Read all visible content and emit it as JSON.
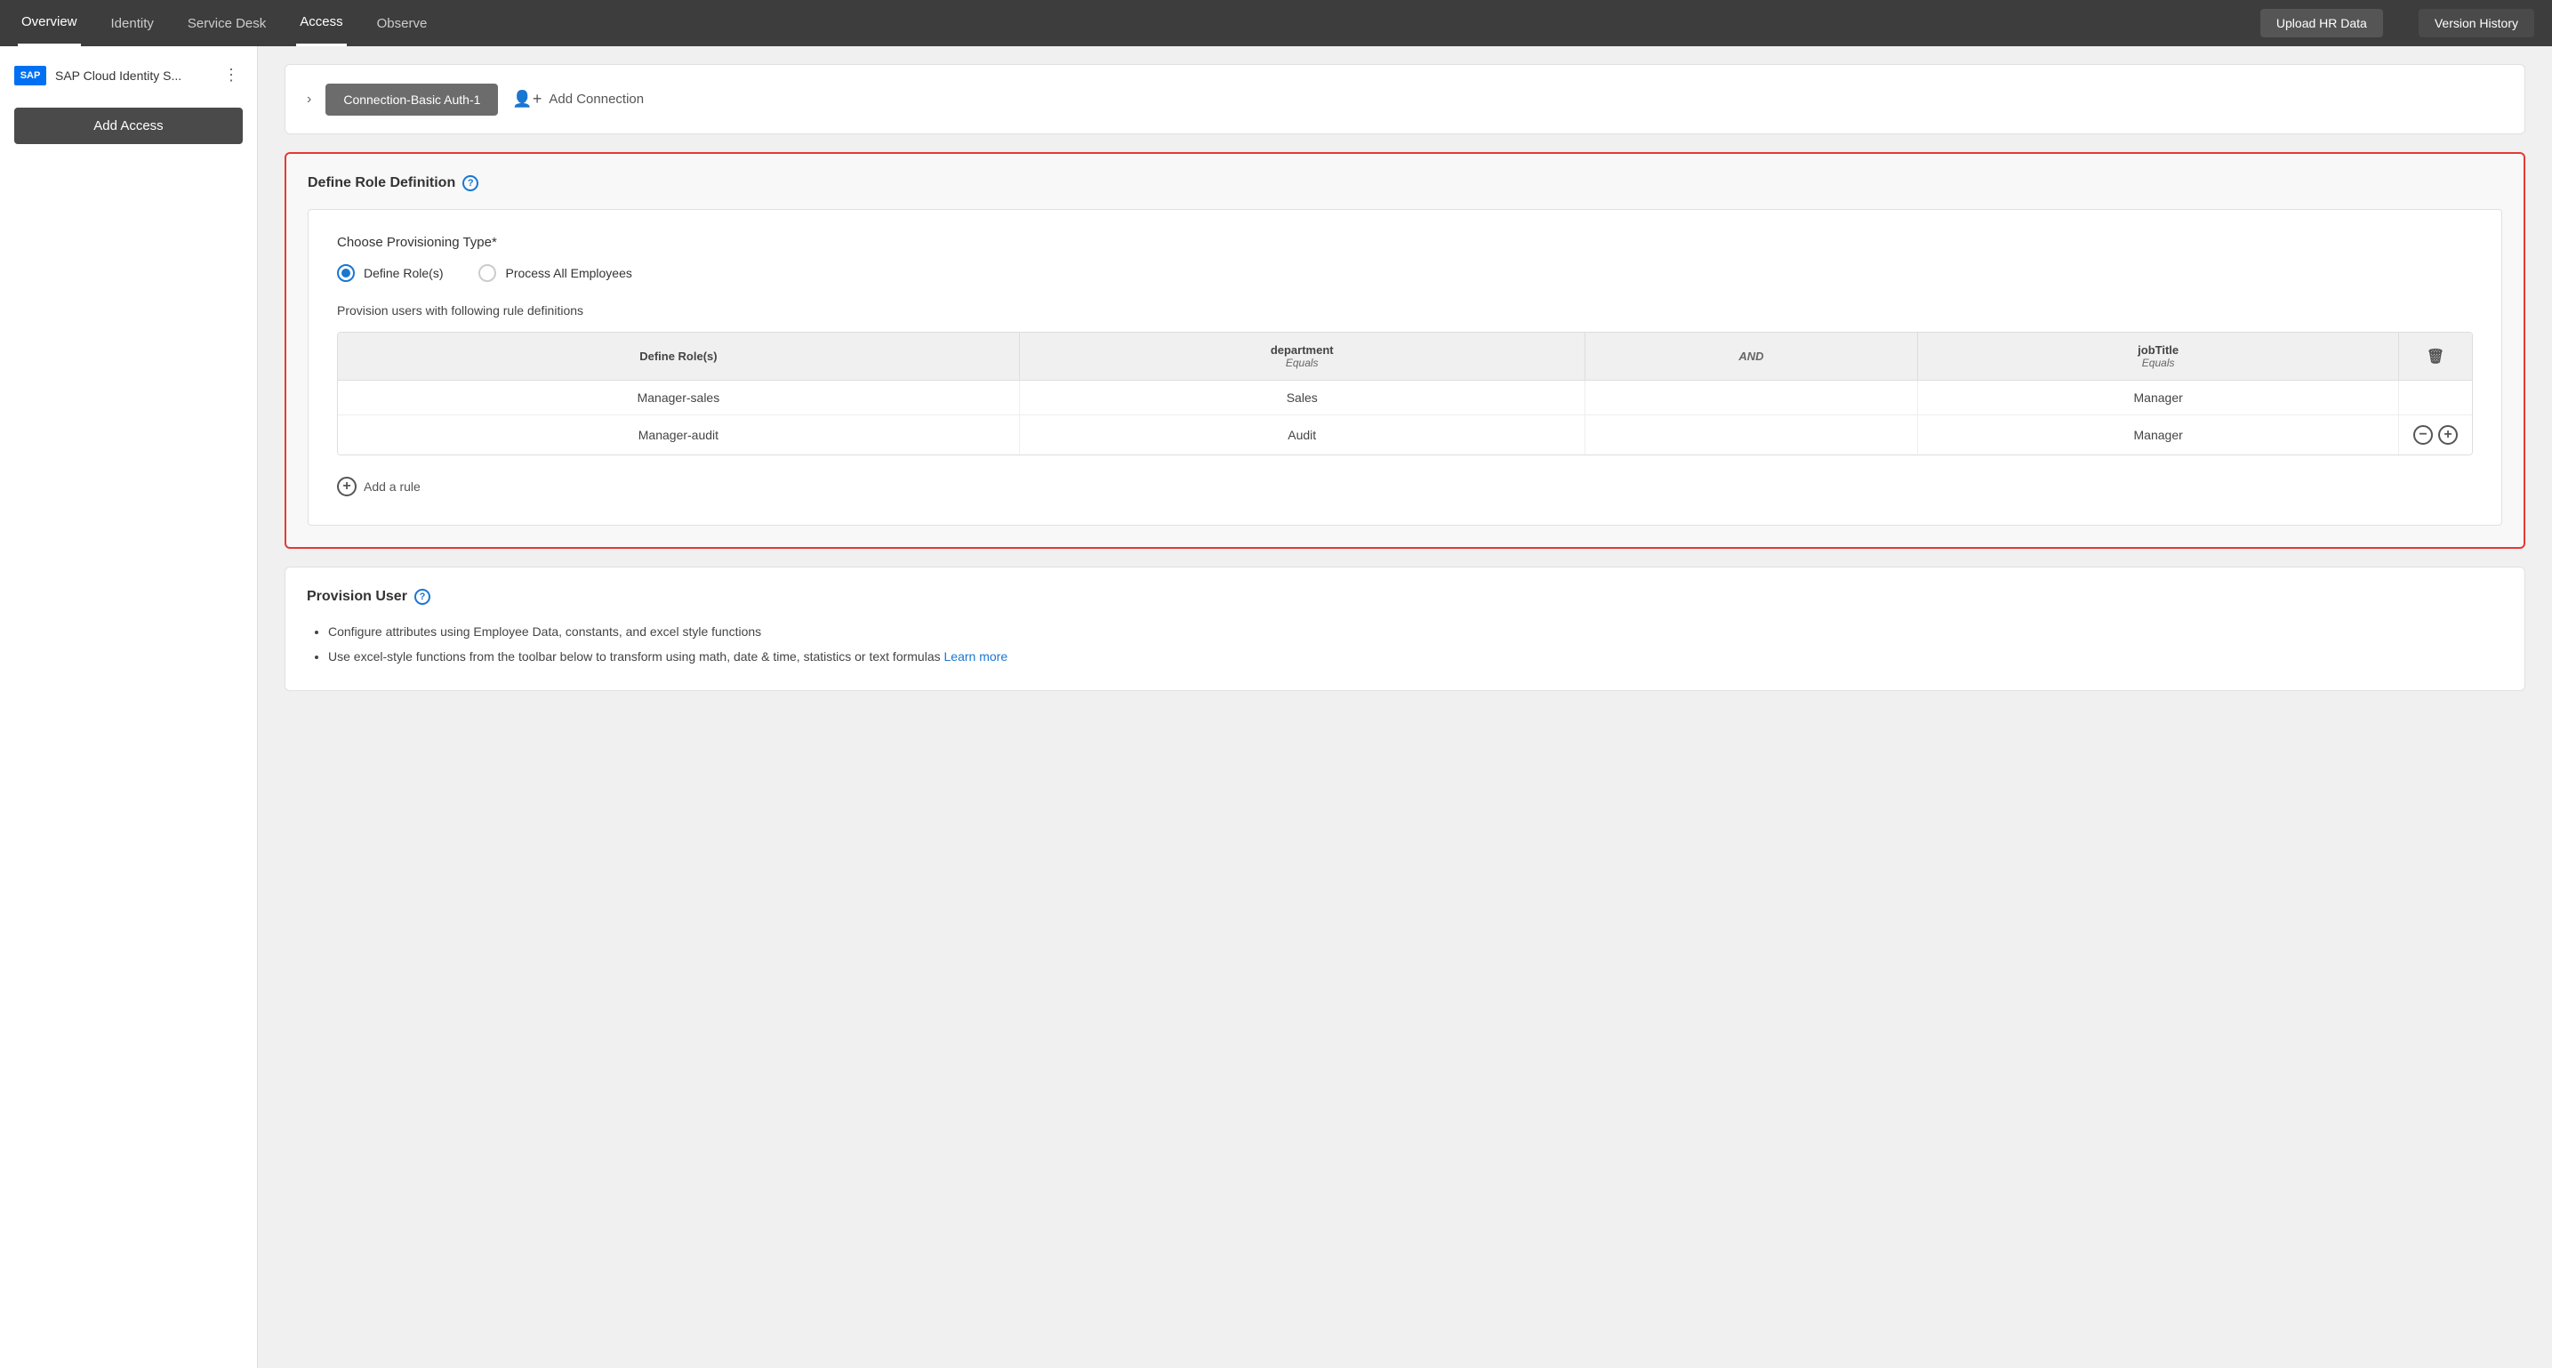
{
  "topNav": {
    "items": [
      {
        "label": "Overview",
        "active": false
      },
      {
        "label": "Identity",
        "active": false
      },
      {
        "label": "Service Desk",
        "active": false
      },
      {
        "label": "Access",
        "active": true
      },
      {
        "label": "Observe",
        "active": false
      }
    ],
    "uploadHRDataLabel": "Upload HR Data",
    "versionHistoryLabel": "Version History"
  },
  "sidebar": {
    "logoText": "SAP",
    "appName": "SAP Cloud Identity S...",
    "addAccessLabel": "Add Access"
  },
  "connection": {
    "connectionBtnLabel": "Connection-Basic Auth-1",
    "addConnectionLabel": "Add Connection",
    "addConnectionIcon": "+"
  },
  "defineRoleSection": {
    "title": "Define Role Definition",
    "helpIcon": "?",
    "provisioningLabel": "Choose Provisioning Type*",
    "radioOptions": [
      {
        "label": "Define Role(s)",
        "selected": true
      },
      {
        "label": "Process All Employees",
        "selected": false
      }
    ],
    "provisionSubtitle": "Provision users with following rule definitions",
    "tableHeaders": {
      "defineRoles": "Define Role(s)",
      "department": "department",
      "departmentSub": "Equals",
      "and": "AND",
      "jobTitle": "jobTitle",
      "jobTitleSub": "Equals"
    },
    "tableRows": [
      {
        "role": "Manager-sales",
        "department": "Sales",
        "jobTitle": "Manager"
      },
      {
        "role": "Manager-audit",
        "department": "Audit",
        "jobTitle": "Manager"
      }
    ],
    "addRuleLabel": "Add a rule"
  },
  "provisionUserSection": {
    "title": "Provision User",
    "helpIcon": "?",
    "bullets": [
      "Configure attributes using Employee Data, constants, and excel style functions",
      "Use excel-style functions from the toolbar below to transform using math, date & time, statistics or text formulas"
    ],
    "learnMoreLabel": "Learn more"
  }
}
